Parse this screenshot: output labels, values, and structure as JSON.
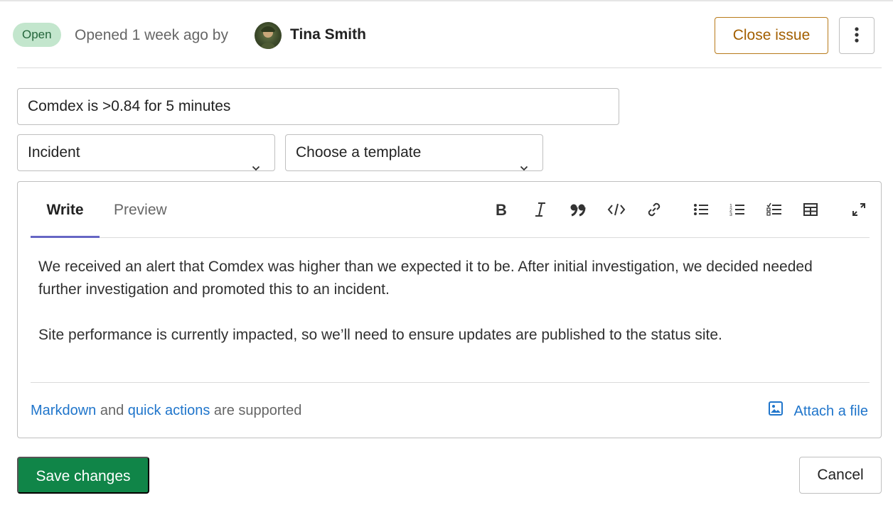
{
  "header": {
    "status": "Open",
    "opened_text": "Opened 1 week ago by",
    "author": "Tina Smith",
    "close_label": "Close issue",
    "more_icon": "vertical-ellipsis-icon"
  },
  "form": {
    "title_value": "Comdex is >0.84 for 5 minutes",
    "type_value": "Incident",
    "template_value": "Choose a template"
  },
  "editor": {
    "tabs": [
      {
        "label": "Write",
        "active": true
      },
      {
        "label": "Preview",
        "active": false
      }
    ],
    "toolbar": [
      "bold-icon",
      "italic-icon",
      "quote-icon",
      "code-icon",
      "link-icon",
      "bullet-list-icon",
      "numbered-list-icon",
      "task-list-icon",
      "table-icon",
      "fullscreen-icon"
    ],
    "paragraphs": [
      "We received an alert that Comdex was higher than we expected it to be. After initial investigation, we decided needed further investigation and promoted this to an incident.",
      "Site performance is currently impacted, so we’ll need to ensure updates are published to the status site."
    ],
    "footer": {
      "markdown_link": "Markdown",
      "and_text": " and ",
      "quick_actions_link": "quick actions",
      "supported_text": " are supported",
      "attach_label": "Attach a file"
    }
  },
  "actions": {
    "save_label": "Save changes",
    "cancel_label": "Cancel"
  },
  "colors": {
    "accent_green": "#108548",
    "link_blue": "#1f75cb",
    "close_orange": "#a35f00",
    "tab_underline": "#6666c4"
  }
}
